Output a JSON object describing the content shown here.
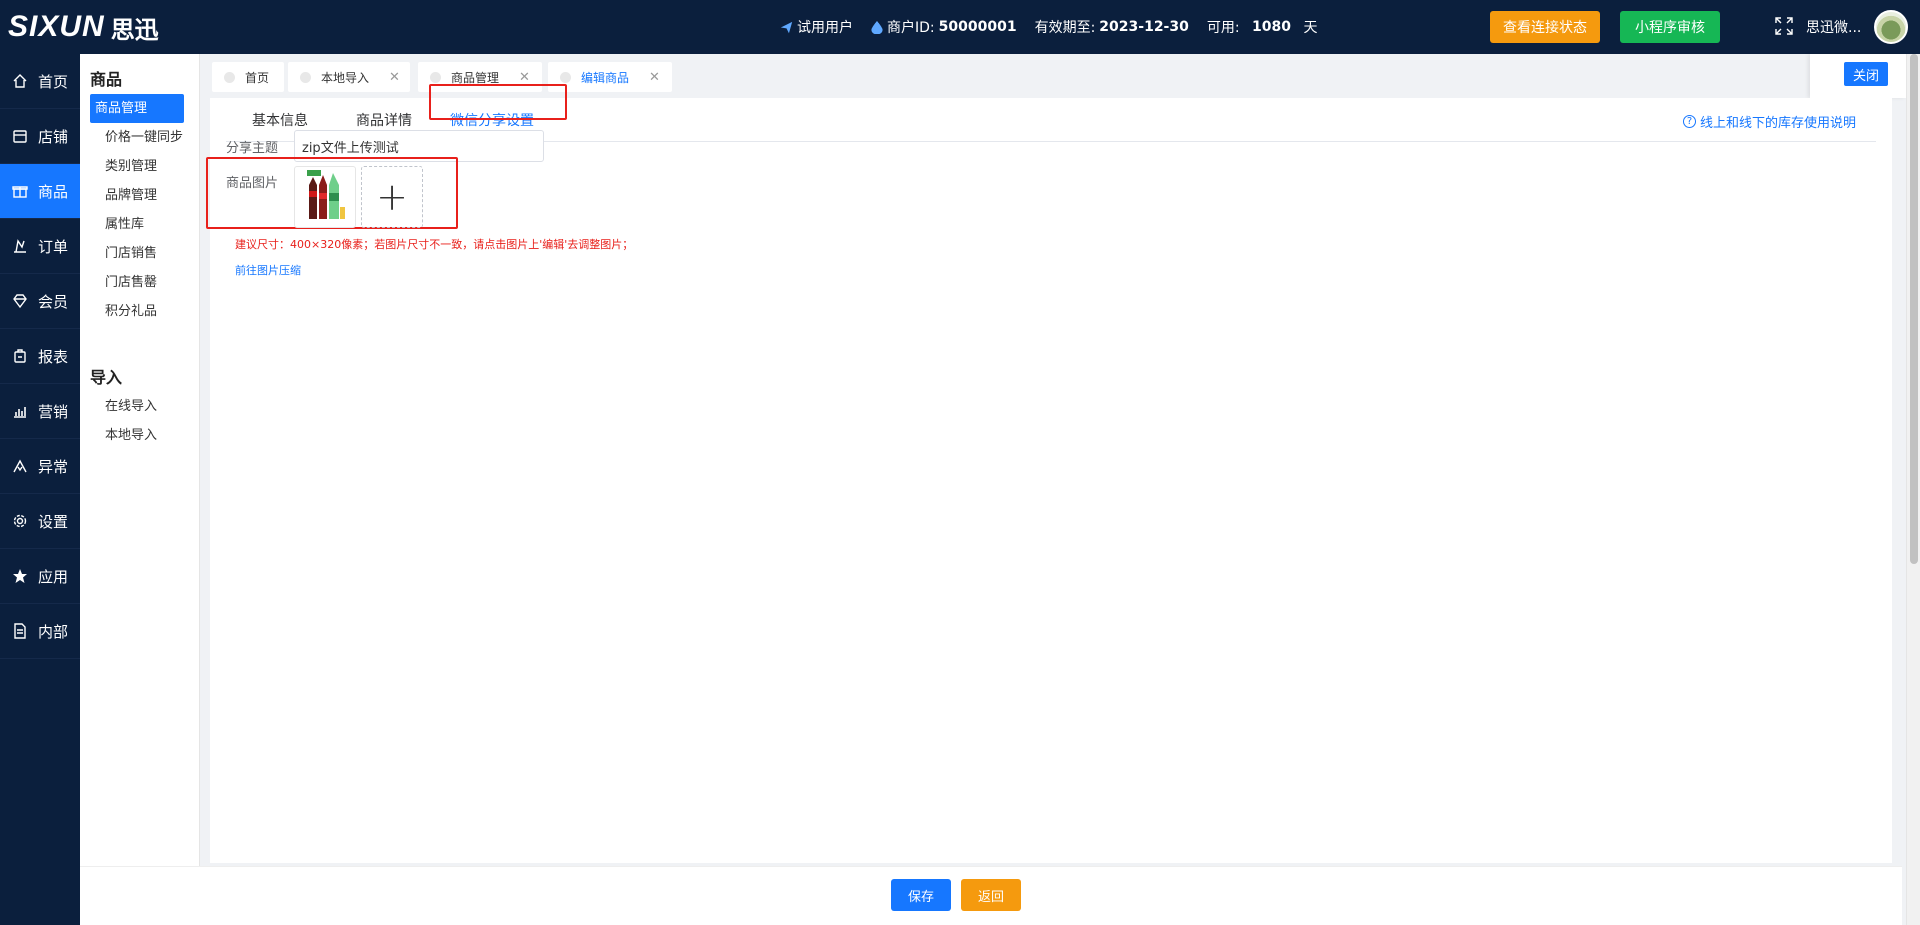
{
  "app": {
    "logo_en": "SIXUN",
    "logo_cn": "思迅"
  },
  "topbar": {
    "user_type": "试用用户",
    "merchant_label": "商户ID:",
    "merchant_id": "50000001",
    "valid_label": "有效期至:",
    "valid_date": "2023-12-30",
    "available_label": "可用:",
    "available_days": "1080",
    "days_unit": "天",
    "connect_status_button": "查看连接状态",
    "miniprogram_button": "小程序审核",
    "username": "思迅微..."
  },
  "leftnav": {
    "items": [
      {
        "label": "首页",
        "icon": "home-icon"
      },
      {
        "label": "店铺",
        "icon": "store-icon"
      },
      {
        "label": "商品",
        "icon": "gift-icon",
        "active": true
      },
      {
        "label": "订单",
        "icon": "order-icon"
      },
      {
        "label": "会员",
        "icon": "diamond-icon"
      },
      {
        "label": "报表",
        "icon": "report-icon"
      },
      {
        "label": "营销",
        "icon": "chart-icon"
      },
      {
        "label": "异常",
        "icon": "warning-icon"
      },
      {
        "label": "设置",
        "icon": "gear-icon"
      },
      {
        "label": "应用",
        "icon": "star-icon"
      },
      {
        "label": "内部",
        "icon": "document-icon"
      }
    ]
  },
  "subnav": {
    "group1_title": "商品",
    "group1_items": [
      "商品管理",
      "价格一键同步",
      "类别管理",
      "品牌管理",
      "属性库",
      "门店销售",
      "门店售罄",
      "积分礼品"
    ],
    "group2_title": "导入",
    "group2_items": [
      "在线导入",
      "本地导入"
    ]
  },
  "tabs": {
    "items": [
      "首页",
      "本地导入",
      "商品管理",
      "编辑商品"
    ],
    "close_button": "关闭"
  },
  "content": {
    "inner_tabs": [
      "基本信息",
      "商品详情",
      "微信分享设置"
    ],
    "help_link": "线上和线下的库存使用说明",
    "share_topic_label": "分享主题",
    "share_topic_value": "zip文件上传测试",
    "image_label": "商品图片",
    "hint": "建议尺寸：400×320像素；若图片尺寸不一致，请点击图片上'编辑'去调整图片；",
    "compress_link": "前往图片压缩"
  },
  "footer": {
    "save": "保存",
    "back": "返回"
  },
  "colors": {
    "primary": "#1677ff",
    "nav_bg": "#0b1f3d",
    "orange": "#f59a0e",
    "green": "#16b755",
    "highlight_red": "#e8201b"
  }
}
